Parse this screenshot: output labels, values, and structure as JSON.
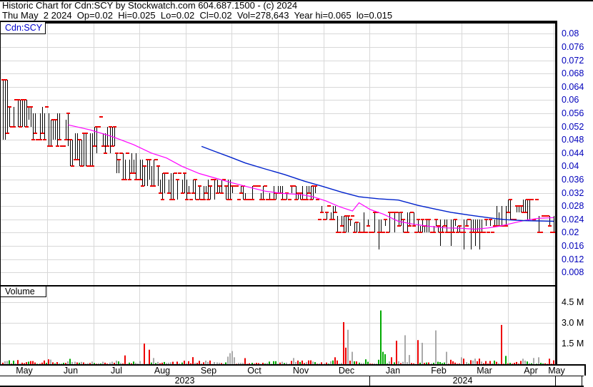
{
  "header": {
    "line1": "Historic Chart for Cdn:SCY by Stockwatch.com 604.687.1500 - (c) 2024",
    "line2": "Thu May  2 2024  Op=0.02  Hi=0.025  Lo=0.02  Cl=0.02  Vol=278,643  Year hi=0.065  lo=0.015"
  },
  "price_panel": {
    "symbol": "Cdn:SCY"
  },
  "volume_panel": {
    "label": "Volume"
  },
  "colors": {
    "bar": "#000000",
    "close_tick": "#ee0000",
    "ma_fast": "#ff00ff",
    "ma_slow": "#0022cc",
    "vol_down": "#ee0000",
    "vol_up": "#00aa00",
    "vol_neutral": "#aaaaaa",
    "grid": "#d8d8d8",
    "price_axis_label": "#0000bb",
    "border": "#000000"
  },
  "chart_data": {
    "type": "ohlc-bar-with-volume",
    "title": "Historic Chart for Cdn:SCY by Stockwatch.com 604.687.1500 - (c) 2024",
    "symbol": "Cdn:SCY",
    "date": "Thu May 2 2024",
    "quote": {
      "open": 0.02,
      "high": 0.025,
      "low": 0.02,
      "close": 0.02,
      "volume": "278,643",
      "year_high": 0.065,
      "year_low": 0.015
    },
    "price_axis": {
      "tick_labels": [
        "0.08",
        "0.076",
        "0.072",
        "0.068",
        "0.064",
        "0.06",
        "0.056",
        "0.052",
        "0.048",
        "0.044",
        "0.04",
        "0.036",
        "0.032",
        "0.028",
        "0.024",
        "0.02",
        "0.016",
        "0.012",
        "0.008"
      ],
      "ticks": [
        0.08,
        0.076,
        0.072,
        0.068,
        0.064,
        0.06,
        0.056,
        0.052,
        0.048,
        0.044,
        0.04,
        0.036,
        0.032,
        0.028,
        0.024,
        0.02,
        0.016,
        0.012,
        0.008
      ],
      "min": 0.008,
      "max": 0.08
    },
    "volume_axis": {
      "tick_labels": [
        "4.5 M",
        "3.0 M",
        "1.5 M"
      ],
      "ticks": [
        4.5,
        3.0,
        1.5
      ],
      "unit": "millions"
    },
    "months": [
      "May",
      "Jun",
      "Jul",
      "Aug",
      "Sep",
      "Oct",
      "Nov",
      "Dec",
      "Jan",
      "Feb",
      "Mar",
      "Apr",
      "May"
    ],
    "years": [
      "2023",
      "2024"
    ],
    "trading_days": 253,
    "price_segments": [
      [
        0,
        2,
        0.066,
        0.048
      ],
      [
        3,
        13,
        0.06,
        0.052
      ],
      [
        14,
        20,
        0.058,
        0.048
      ],
      [
        21,
        30,
        0.056,
        0.046
      ],
      [
        31,
        41,
        0.05,
        0.04
      ],
      [
        42,
        51,
        0.052,
        0.044
      ],
      [
        52,
        62,
        0.044,
        0.036
      ],
      [
        63,
        71,
        0.042,
        0.034
      ],
      [
        72,
        83,
        0.038,
        0.03
      ],
      [
        84,
        104,
        0.036,
        0.03
      ],
      [
        105,
        125,
        0.034,
        0.03
      ],
      [
        126,
        143,
        0.034,
        0.03
      ],
      [
        144,
        147,
        0.03,
        0.024
      ],
      [
        148,
        152,
        0.028,
        0.024
      ],
      [
        153,
        163,
        0.025,
        0.02
      ],
      [
        164,
        167,
        0.026,
        0.02
      ],
      [
        168,
        188,
        0.026,
        0.02
      ],
      [
        189,
        209,
        0.024,
        0.02
      ],
      [
        210,
        225,
        0.024,
        0.02
      ],
      [
        226,
        230,
        0.028,
        0.022
      ],
      [
        231,
        244,
        0.03,
        0.024
      ],
      [
        245,
        251,
        0.025,
        0.02
      ]
    ],
    "special_marks": [
      [
        45,
        0.055
      ]
    ],
    "low_wicks": [
      [
        172,
        0.015
      ],
      [
        200,
        0.016
      ],
      [
        205,
        0.016
      ],
      [
        211,
        0.015
      ],
      [
        214,
        0.015
      ],
      [
        216,
        0.016
      ],
      [
        218,
        0.015
      ]
    ],
    "last_day": {
      "open": 0.02,
      "high": 0.025,
      "low": 0.02,
      "close": 0.02
    },
    "ma_fast": [
      [
        30,
        0.0525
      ],
      [
        40,
        0.051
      ],
      [
        50,
        0.049
      ],
      [
        60,
        0.0465
      ],
      [
        68,
        0.044
      ],
      [
        75,
        0.0425
      ],
      [
        82,
        0.04
      ],
      [
        90,
        0.0378
      ],
      [
        98,
        0.0363
      ],
      [
        105,
        0.035
      ],
      [
        112,
        0.0338
      ],
      [
        120,
        0.0325
      ],
      [
        128,
        0.0318
      ],
      [
        136,
        0.0315
      ],
      [
        142,
        0.0308
      ],
      [
        148,
        0.0295
      ],
      [
        154,
        0.0278
      ],
      [
        160,
        0.0265
      ],
      [
        163,
        0.029
      ],
      [
        168,
        0.027
      ],
      [
        174,
        0.0256
      ],
      [
        181,
        0.0234
      ],
      [
        188,
        0.0225
      ],
      [
        195,
        0.0219
      ],
      [
        203,
        0.0214
      ],
      [
        210,
        0.0213
      ],
      [
        216,
        0.021
      ],
      [
        222,
        0.0214
      ],
      [
        227,
        0.0219
      ],
      [
        233,
        0.0228
      ],
      [
        239,
        0.0237
      ],
      [
        245,
        0.0243
      ],
      [
        252,
        0.0245
      ]
    ],
    "ma_slow": [
      [
        91,
        0.046
      ],
      [
        97,
        0.0445
      ],
      [
        104,
        0.0428
      ],
      [
        111,
        0.041
      ],
      [
        120,
        0.0392
      ],
      [
        129,
        0.0375
      ],
      [
        138,
        0.0355
      ],
      [
        146,
        0.034
      ],
      [
        155,
        0.0322
      ],
      [
        163,
        0.0308
      ],
      [
        172,
        0.0302
      ],
      [
        181,
        0.0298
      ],
      [
        190,
        0.0282
      ],
      [
        197,
        0.0272
      ],
      [
        205,
        0.0261
      ],
      [
        214,
        0.0252
      ],
      [
        223,
        0.0244
      ],
      [
        230,
        0.0239
      ],
      [
        238,
        0.0236
      ],
      [
        245,
        0.0235
      ],
      [
        252,
        0.0234
      ]
    ],
    "volume_spikes": [
      [
        7,
        0.3,
        "down"
      ],
      [
        21,
        0.35,
        "down"
      ],
      [
        65,
        1.5,
        "down"
      ],
      [
        67,
        1.05,
        "down"
      ],
      [
        69,
        0.45,
        "neutral"
      ],
      [
        103,
        0.55,
        "neutral"
      ],
      [
        104,
        0.8,
        "neutral"
      ],
      [
        105,
        0.95,
        "neutral"
      ],
      [
        106,
        0.5,
        "neutral"
      ],
      [
        133,
        0.45,
        "neutral"
      ],
      [
        152,
        0.5,
        "down"
      ],
      [
        156,
        3.05,
        "down"
      ],
      [
        157,
        1.2,
        "down"
      ],
      [
        158,
        2.5,
        "neutral"
      ],
      [
        160,
        0.9,
        "neutral"
      ],
      [
        166,
        0.35,
        "up"
      ],
      [
        173,
        3.9,
        "up"
      ],
      [
        174,
        0.9,
        "up"
      ],
      [
        178,
        0.5,
        "down"
      ],
      [
        180,
        1.7,
        "down"
      ],
      [
        184,
        2.1,
        "neutral"
      ],
      [
        190,
        1.75,
        "down"
      ],
      [
        192,
        1.55,
        "neutral"
      ],
      [
        198,
        2.45,
        "neutral"
      ],
      [
        203,
        0.9,
        "neutral"
      ],
      [
        210,
        0.5,
        "neutral"
      ],
      [
        228,
        2.85,
        "down"
      ],
      [
        230,
        0.6,
        "up"
      ],
      [
        243,
        0.45,
        "neutral"
      ],
      [
        245,
        0.5,
        "neutral"
      ],
      [
        250,
        0.4,
        "down"
      ]
    ]
  }
}
